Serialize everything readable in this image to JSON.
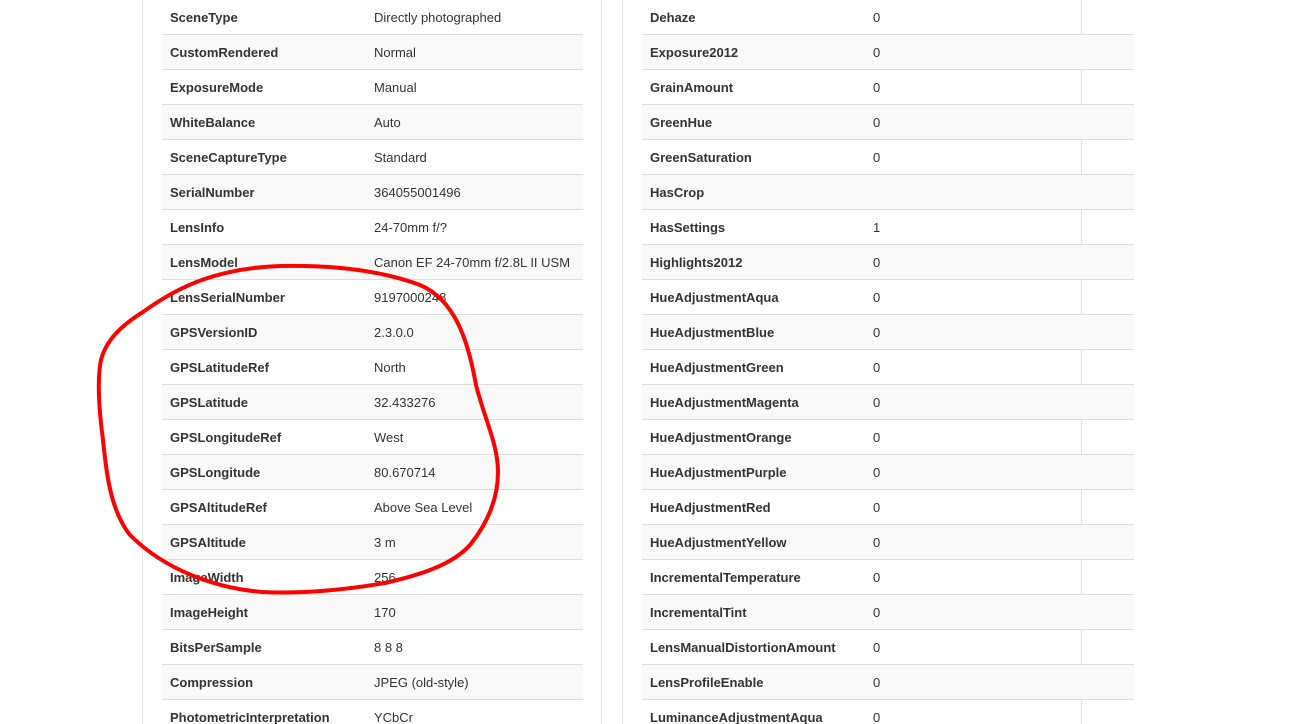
{
  "left_table": [
    {
      "key": "SceneType",
      "value": "Directly photographed"
    },
    {
      "key": "CustomRendered",
      "value": "Normal"
    },
    {
      "key": "ExposureMode",
      "value": "Manual"
    },
    {
      "key": "WhiteBalance",
      "value": "Auto"
    },
    {
      "key": "SceneCaptureType",
      "value": "Standard"
    },
    {
      "key": "SerialNumber",
      "value": "364055001496"
    },
    {
      "key": "LensInfo",
      "value": "24-70mm f/?"
    },
    {
      "key": "LensModel",
      "value": "Canon EF 24-70mm f/2.8L II USM"
    },
    {
      "key": "LensSerialNumber",
      "value": "9197000248"
    },
    {
      "key": "GPSVersionID",
      "value": "2.3.0.0"
    },
    {
      "key": "GPSLatitudeRef",
      "value": "North"
    },
    {
      "key": "GPSLatitude",
      "value": "32.433276"
    },
    {
      "key": "GPSLongitudeRef",
      "value": "West"
    },
    {
      "key": "GPSLongitude",
      "value": "80.670714"
    },
    {
      "key": "GPSAltitudeRef",
      "value": "Above Sea Level"
    },
    {
      "key": "GPSAltitude",
      "value": "3 m"
    },
    {
      "key": "ImageWidth",
      "value": "256"
    },
    {
      "key": "ImageHeight",
      "value": "170"
    },
    {
      "key": "BitsPerSample",
      "value": "8 8 8"
    },
    {
      "key": "Compression",
      "value": "JPEG (old-style)"
    },
    {
      "key": "PhotometricInterpretation",
      "value": "YCbCr"
    }
  ],
  "right_table": [
    {
      "key": "Dehaze",
      "value": "0"
    },
    {
      "key": "Exposure2012",
      "value": "0"
    },
    {
      "key": "GrainAmount",
      "value": "0"
    },
    {
      "key": "GreenHue",
      "value": "0"
    },
    {
      "key": "GreenSaturation",
      "value": "0"
    },
    {
      "key": "HasCrop",
      "value": ""
    },
    {
      "key": "HasSettings",
      "value": "1"
    },
    {
      "key": "Highlights2012",
      "value": "0"
    },
    {
      "key": "HueAdjustmentAqua",
      "value": "0"
    },
    {
      "key": "HueAdjustmentBlue",
      "value": "0"
    },
    {
      "key": "HueAdjustmentGreen",
      "value": "0"
    },
    {
      "key": "HueAdjustmentMagenta",
      "value": "0"
    },
    {
      "key": "HueAdjustmentOrange",
      "value": "0"
    },
    {
      "key": "HueAdjustmentPurple",
      "value": "0"
    },
    {
      "key": "HueAdjustmentRed",
      "value": "0"
    },
    {
      "key": "HueAdjustmentYellow",
      "value": "0"
    },
    {
      "key": "IncrementalTemperature",
      "value": "0"
    },
    {
      "key": "IncrementalTint",
      "value": "0"
    },
    {
      "key": "LensManualDistortionAmount",
      "value": "0"
    },
    {
      "key": "LensProfileEnable",
      "value": "0"
    },
    {
      "key": "LuminanceAdjustmentAqua",
      "value": "0"
    }
  ],
  "annotation": {
    "shape": "hand-drawn-circle",
    "color": "#ff0000"
  }
}
